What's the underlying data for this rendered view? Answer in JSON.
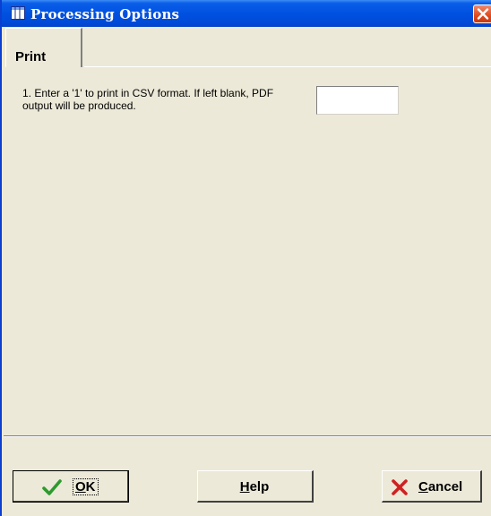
{
  "window": {
    "title": "Processing Options"
  },
  "tabs": [
    {
      "label": "Print",
      "active": true
    }
  ],
  "options": [
    {
      "text": "1. Enter a '1' to print in CSV format.  If left blank, PDF output will be produced.",
      "value": ""
    }
  ],
  "buttons": {
    "ok": {
      "underline": "O",
      "rest": "K",
      "icon": "checkmark-icon"
    },
    "help": {
      "underline": "H",
      "rest": "elp"
    },
    "cancel": {
      "underline": "C",
      "rest": "ancel",
      "icon": "x-icon"
    }
  },
  "colors": {
    "titlebar": "#0051e0",
    "window_bg": "#ece9d8",
    "close_button": "#e04a1e",
    "check_green": "#2e9a2e",
    "cancel_red": "#d02020"
  }
}
